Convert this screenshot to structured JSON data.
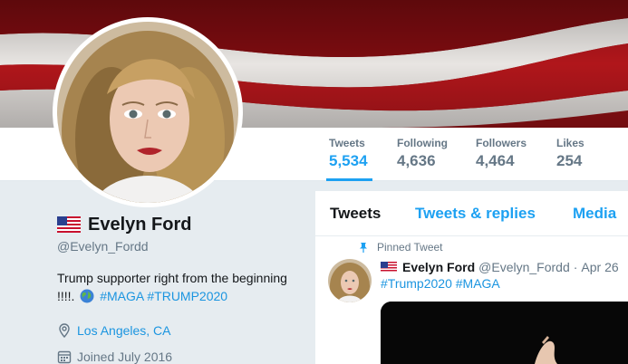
{
  "banner": {
    "icon": "us-flag-banner"
  },
  "stats": [
    {
      "label": "Tweets",
      "value": "5,534",
      "active": true
    },
    {
      "label": "Following",
      "value": "4,636",
      "active": false
    },
    {
      "label": "Followers",
      "value": "4,464",
      "active": false
    },
    {
      "label": "Likes",
      "value": "254",
      "active": false
    }
  ],
  "profile": {
    "flag_icon": "us-flag-icon",
    "name": "Evelyn Ford",
    "handle": "@Evelyn_Fordd",
    "bio_text": "Trump supporter right from the beginning !!!!.",
    "bio_globe_icon": "globe-icon",
    "bio_tags": "#MAGA #TRUMP2020",
    "location": "Los Angeles, CA",
    "location_icon": "location-pin-icon",
    "joined": "Joined July 2016",
    "joined_icon": "calendar-icon"
  },
  "timeline": {
    "tabs": [
      "Tweets",
      "Tweets & replies",
      "Media"
    ],
    "selected_tab": "Tweets",
    "pinned_label": "Pinned Tweet",
    "pinned_icon": "pin-icon",
    "tweet": {
      "name": "Evelyn Ford",
      "handle": "@Evelyn_Fordd",
      "date": "Apr 26",
      "text": "#Trump2020 #MAGA"
    }
  },
  "colors": {
    "accent": "#1da1f2",
    "link": "#1b95e0",
    "muted": "#657786",
    "text": "#14171a",
    "page_bg": "#e6ecf0"
  }
}
